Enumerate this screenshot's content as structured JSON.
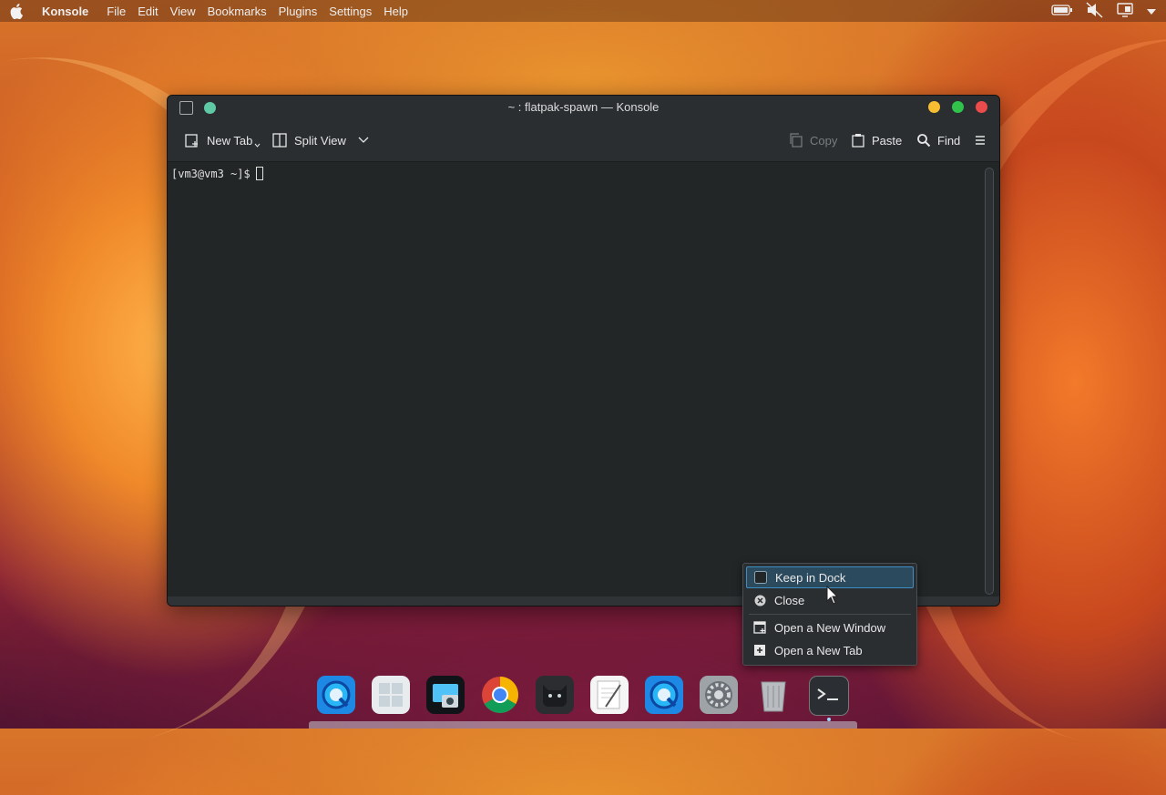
{
  "menubar": {
    "app_name": "Konsole",
    "items": [
      "File",
      "Edit",
      "View",
      "Bookmarks",
      "Plugins",
      "Settings",
      "Help"
    ]
  },
  "window": {
    "title": "~ : flatpak-spawn — Konsole",
    "toolbar": {
      "new_tab": "New Tab",
      "split_view": "Split View",
      "copy": "Copy",
      "paste": "Paste",
      "find": "Find"
    },
    "prompt": "[vm3@vm3 ~]$"
  },
  "context_menu": {
    "items": [
      {
        "label": "Keep in Dock",
        "icon": "checkbox-icon"
      },
      {
        "label": "Close",
        "icon": "close-circle-icon"
      },
      {
        "label": "Open a New Window",
        "icon": "new-window-icon"
      },
      {
        "label": "Open a New Tab",
        "icon": "new-tab-icon"
      }
    ]
  },
  "dock": {
    "apps": [
      "quicktime",
      "launchpad",
      "screenshot",
      "chrome",
      "cat-app",
      "textedit",
      "quicktime",
      "system-settings",
      "trash",
      "terminal"
    ]
  },
  "colors": {
    "minimize": "#f5bd2f",
    "maximize": "#30c24a",
    "close": "#ec4b4b",
    "pin_dot": "#5ec9a4",
    "highlight": "#3d8ec2"
  }
}
